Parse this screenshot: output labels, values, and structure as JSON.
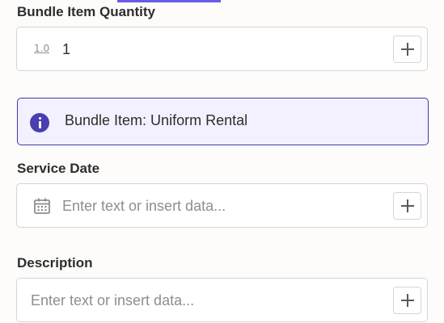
{
  "fields": {
    "bundle_item_quantity": {
      "label": "Bundle Item Quantity",
      "type_icon": "1.0",
      "value": "1"
    },
    "service_date": {
      "label": "Service Date",
      "placeholder": "Enter text or insert data..."
    },
    "description": {
      "label": "Description",
      "placeholder": "Enter text or insert data..."
    }
  },
  "banner": {
    "text": "Bundle Item: Uniform Rental",
    "icon": "info-icon"
  },
  "icons": {
    "number_type": "number-type-icon",
    "calendar": "calendar-icon",
    "plus": "plus-icon"
  },
  "colors": {
    "accent": "#695be8",
    "banner_bg": "#f3f1ff",
    "banner_border": "#3d3a9e",
    "info_icon": "#4a3fb0"
  }
}
